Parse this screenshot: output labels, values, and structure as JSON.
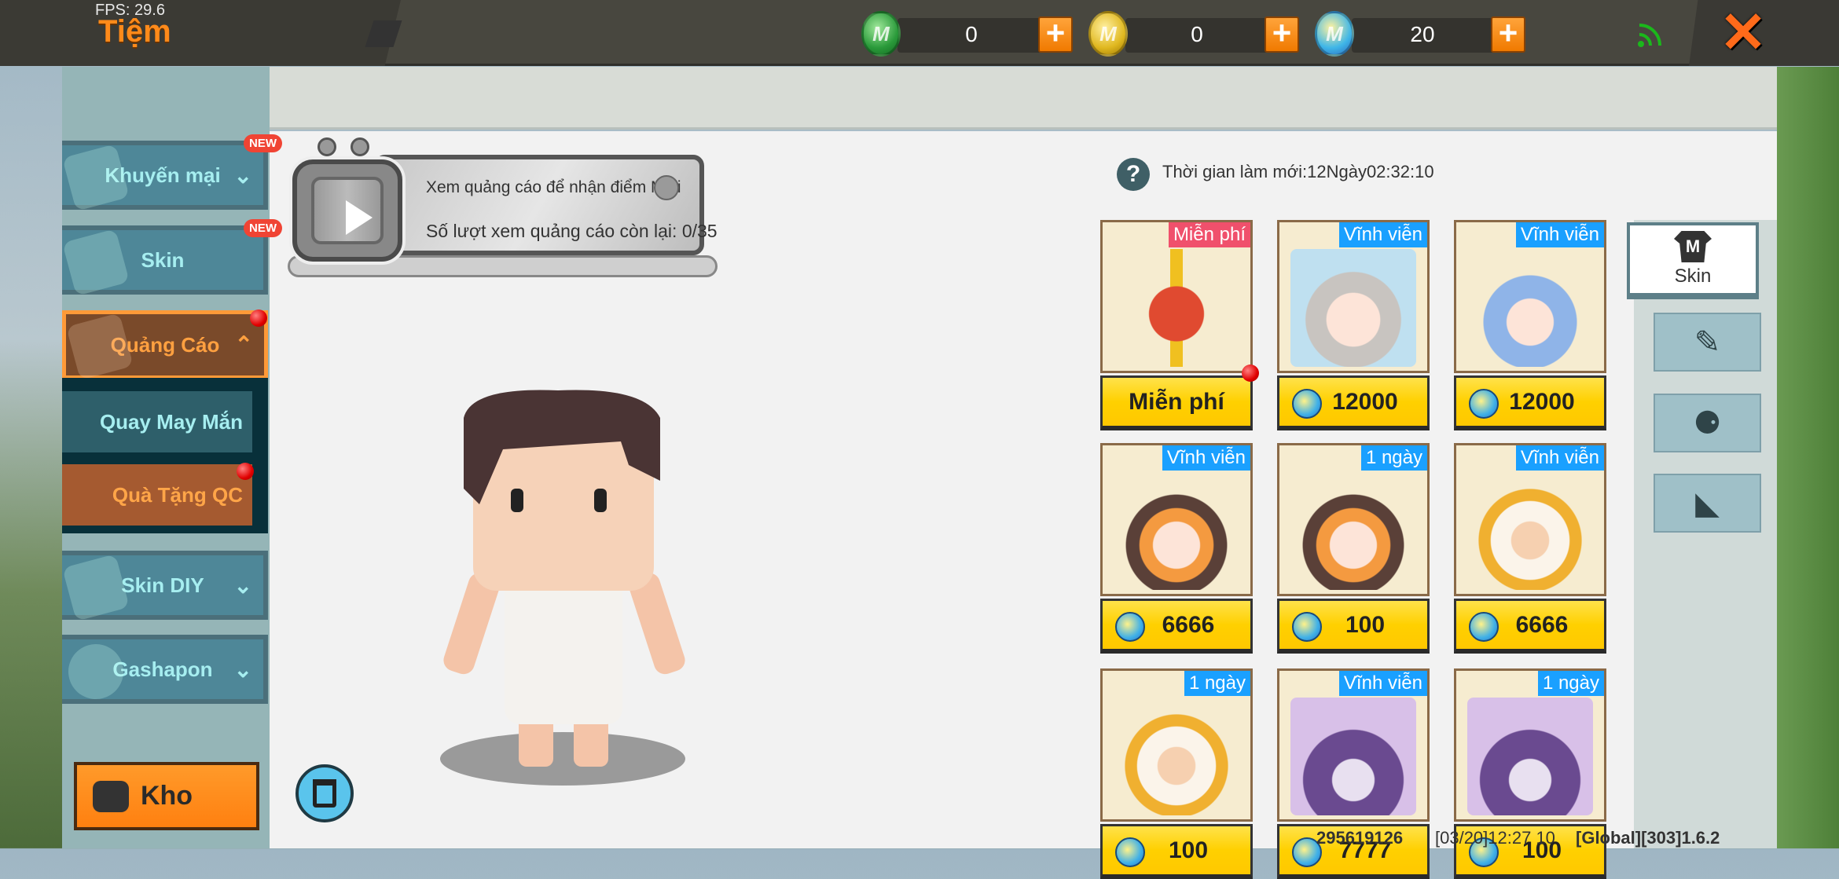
{
  "topbar": {
    "fps": "FPS: 29.6",
    "title": "Tiệm",
    "currencies": [
      {
        "icon": "green-gem-icon",
        "value": "0"
      },
      {
        "icon": "gold-coin-icon",
        "value": "0"
      },
      {
        "icon": "mini-coin-icon",
        "value": "20"
      }
    ],
    "plus": "+",
    "close": "✕"
  },
  "sidebar": {
    "new_badge": "NEW",
    "items": [
      {
        "label": "Khuyến mại",
        "chevron": "⌄"
      },
      {
        "label": "Skin"
      },
      {
        "label": "Quảng Cáo",
        "chevron": "⌃"
      },
      {
        "label": "Quay May Mắn"
      },
      {
        "label": "Quà Tặng QC"
      },
      {
        "label": "Skin DIY",
        "chevron": "⌄"
      },
      {
        "label": "Gashapon",
        "chevron": "⌄"
      }
    ],
    "kho": "Kho"
  },
  "ad": {
    "line1": "Xem quảng cáo để nhận điểm Mini",
    "line2": "Số lượt xem quảng cáo còn lại: 0/35"
  },
  "refresh": {
    "help": "?",
    "text": "Thời gian làm mới:12Ngày02:32:10"
  },
  "items": [
    {
      "tag": "Miễn phí",
      "tag_type": "free",
      "price": "Miễn phí",
      "coin": false,
      "art": "gift-icon",
      "dot": true
    },
    {
      "tag": "Vĩnh viễn",
      "tag_type": "blue",
      "price": "12000",
      "coin": true,
      "art": "skin-girl-gray"
    },
    {
      "tag": "Vĩnh viễn",
      "tag_type": "blue",
      "price": "12000",
      "coin": true,
      "art": "skin-boy-blue"
    },
    {
      "tag": "Vĩnh viễn",
      "tag_type": "blue",
      "price": "6666",
      "coin": true,
      "art": "skin-detective"
    },
    {
      "tag": "1 ngày",
      "tag_type": "blue",
      "price": "100",
      "coin": true,
      "art": "skin-detective"
    },
    {
      "tag": "Vĩnh viễn",
      "tag_type": "blue",
      "price": "6666",
      "coin": true,
      "art": "skin-mascot"
    },
    {
      "tag": "1 ngày",
      "tag_type": "blue",
      "price": "100",
      "coin": true,
      "art": "skin-mascot"
    },
    {
      "tag": "Vĩnh viễn",
      "tag_type": "blue",
      "price": "7777",
      "coin": true,
      "art": "skin-purple-girl"
    },
    {
      "tag": "1 ngày",
      "tag_type": "blue",
      "price": "100",
      "coin": true,
      "art": "skin-purple-girl"
    }
  ],
  "tabs": {
    "skin": "Skin",
    "shirt_letter": "M"
  },
  "debug": {
    "uid": "295619126",
    "time": "[03/20]12:27 10",
    "version": "[Global][303]1.6.2"
  },
  "colors": {
    "accent": "#ff8a1a",
    "panel": "#95b5b7",
    "item": "#4e8798",
    "price": "#ffd400"
  }
}
